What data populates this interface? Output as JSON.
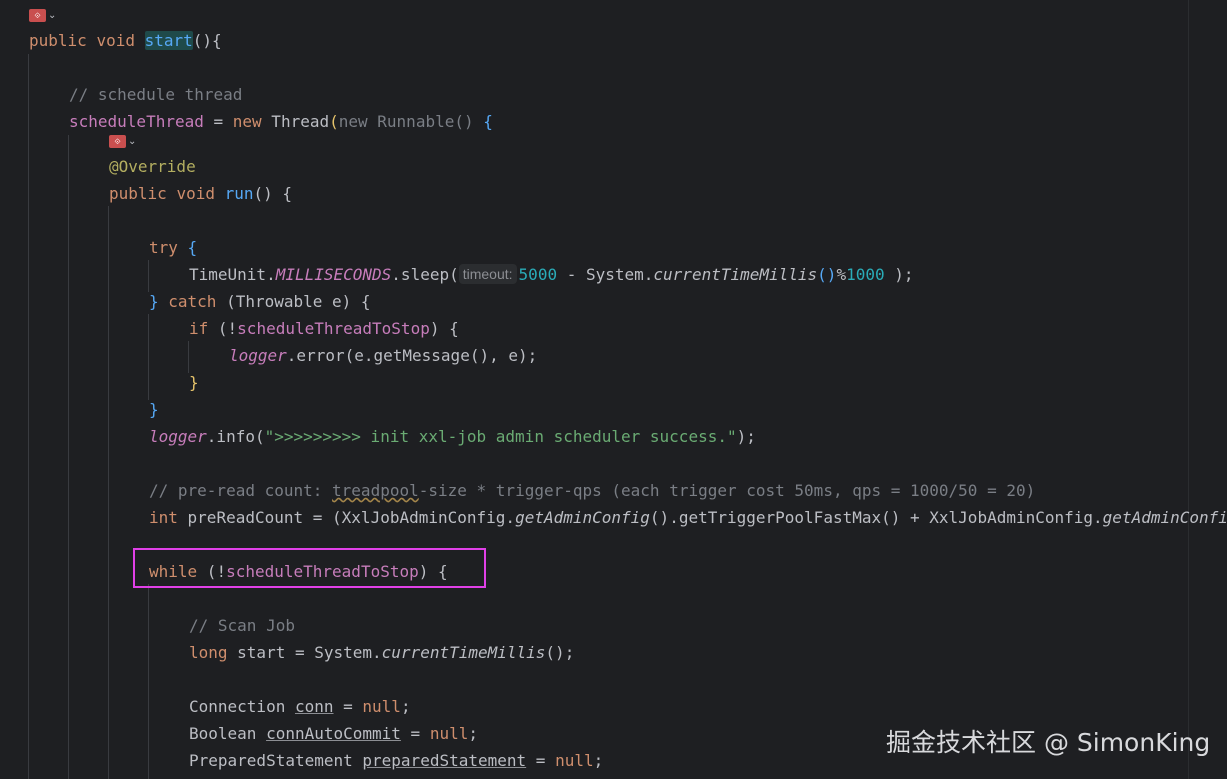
{
  "gutter": {
    "badge_icon": "plugin-badge-icon",
    "badge_text": "⟐",
    "chevron_icon": "chevron-down-icon",
    "chevron_text": "⌄"
  },
  "code": {
    "l1": {
      "kw1": "public",
      "kw2": "void",
      "name": "start",
      "rest": "(){"
    },
    "l2": {
      "comment": "// schedule thread"
    },
    "l3": {
      "field": "scheduleThread",
      "eq": " = ",
      "kw_new": "new",
      "cls": " Thread",
      "paren": "(",
      "anon": "new Runnable()",
      "brace": " {"
    },
    "l4": {
      "annotation": "@Override"
    },
    "l5": {
      "kw1": "public",
      "kw2": "void",
      "name": "run",
      "rest": "() {"
    },
    "l6": {
      "kw": "try",
      "brace": " {"
    },
    "l7": {
      "cls": "TimeUnit.",
      "const": "MILLISECONDS",
      "call": ".sleep(",
      "hint": "timeout:",
      "num1": "5000",
      "minus": " - System.",
      "method": "currentTimeMillis",
      "paren": "()",
      "mod": "%",
      "num2": "1000",
      "end": " );"
    },
    "l8": {
      "close": "} ",
      "kw": "catch",
      "rest": " (Throwable e) {"
    },
    "l9": {
      "kw": "if",
      "open": " (!",
      "field": "scheduleThreadToStop",
      "rest": ") {"
    },
    "l10": {
      "logger": "logger",
      "rest": ".error(e.getMessage(), e);"
    },
    "l11": {
      "close": "}"
    },
    "l12": {
      "close": "}"
    },
    "l13": {
      "logger": "logger",
      "call": ".info(",
      "str": "\">>>>>>>>> init xxl-job admin scheduler success.\"",
      "end": ");"
    },
    "l14": {
      "c1": "// pre-read count: ",
      "c_warn": "treadpool",
      "c2": "-size * trigger-qps (each trigger cost 50ms, qps = 1000/50 = 20)"
    },
    "l15": {
      "kw": "int",
      "decl": " preReadCount = (XxlJobAdminConfig.",
      "m1": "getAdminConfig",
      "mid": "().getTriggerPoolFastMax() + XxlJobAdminConfig.",
      "m2": "getAdminConfig"
    },
    "l16": {
      "kw": "while",
      "open": " (!",
      "field": "scheduleThreadToStop",
      "rest": ") {"
    },
    "l17": {
      "comment": "// Scan Job"
    },
    "l18": {
      "kw": "long",
      "decl": " start = System.",
      "method": "currentTimeMillis",
      "end": "();"
    },
    "l19": {
      "type": "Connection ",
      "var": "conn",
      "eq": " = ",
      "kw": "null",
      "end": ";"
    },
    "l20": {
      "type": "Boolean ",
      "var": "connAutoCommit",
      "eq": " = ",
      "kw": "null",
      "end": ";"
    },
    "l21": {
      "type": "PreparedStatement ",
      "var": "preparedStatement",
      "eq": " = ",
      "kw": "null",
      "end": ";"
    }
  },
  "watermark": "掘金技术社区 @ SimonKing",
  "colors": {
    "background": "#1e1f22",
    "keyword": "#cf8e6d",
    "function": "#56a8f5",
    "comment": "#7a7e85",
    "highlight_box": "#e040e8"
  }
}
